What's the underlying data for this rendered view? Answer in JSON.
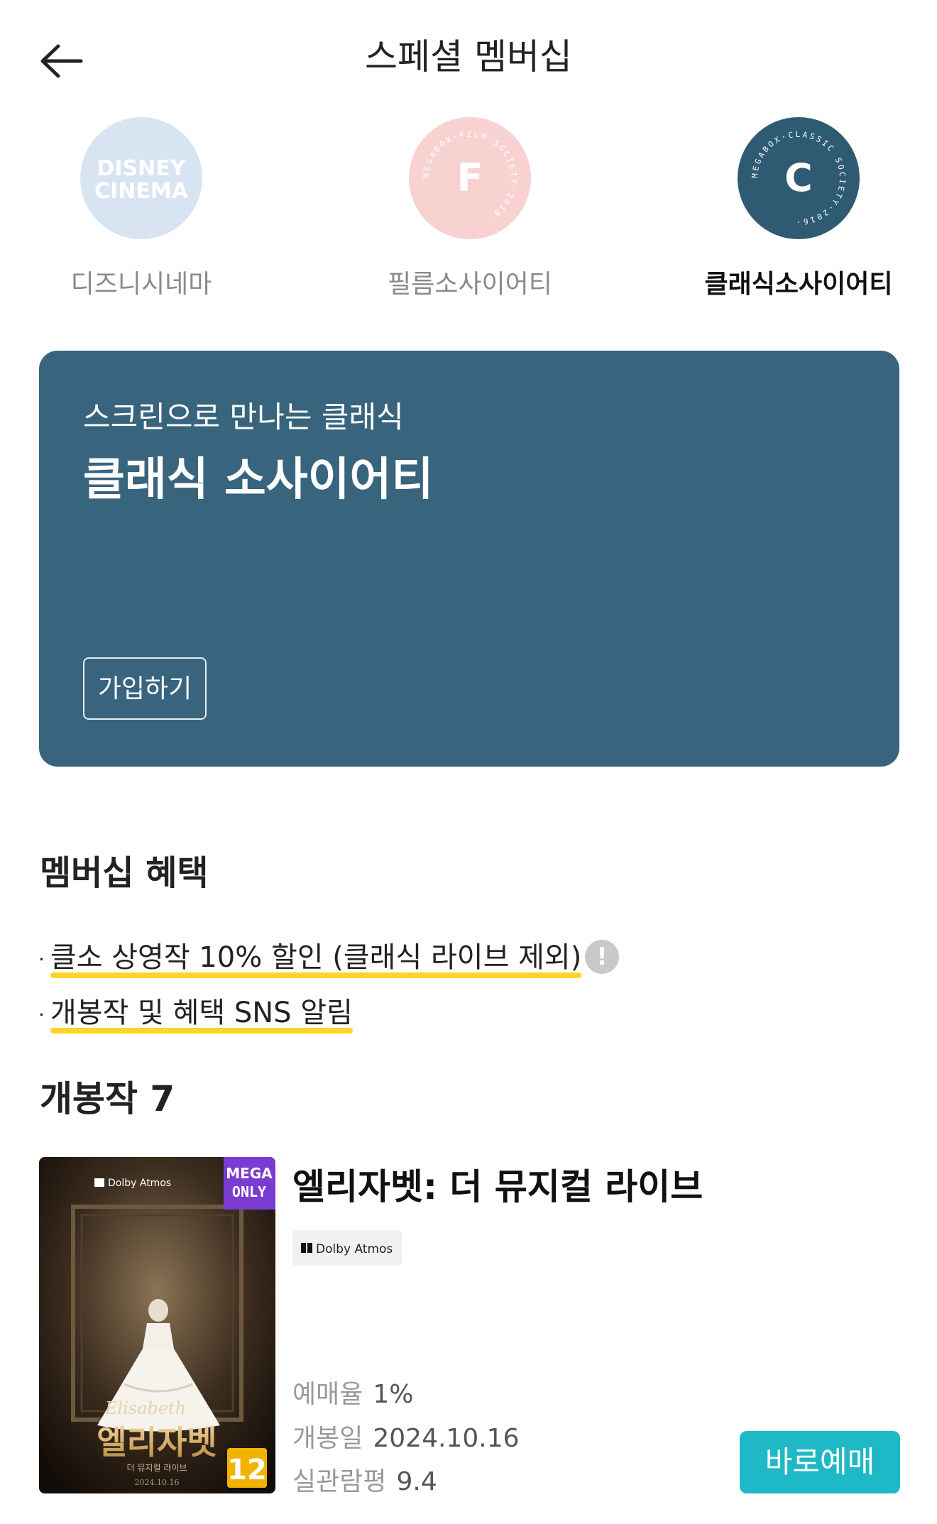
{
  "header": {
    "title": "스페셜 멤버십",
    "back_icon": "arrow-left-icon"
  },
  "tabs": [
    {
      "label": "디즈니시네마",
      "logo_text": "DISNEY CINEMA",
      "color": "#d9e4f3",
      "active": false
    },
    {
      "label": "필름소사이어티",
      "logo_letter": "F",
      "ring_text": "MEGABOX·FILM SOCIETY·2018",
      "color": "#f7d2d1",
      "active": false
    },
    {
      "label": "클래식소사이어티",
      "logo_letter": "C",
      "ring_text": "MEGABOX·CLASSIC SOCIETY·2016",
      "color": "#2f5b72",
      "active": true
    }
  ],
  "banner": {
    "subtitle": "스크린으로 만나는 클래식",
    "title": "클래식 소사이어티",
    "join_label": "가입하기",
    "background": "#38647d"
  },
  "benefits": {
    "title": "멤버십 혜택",
    "items": [
      "클소 상영작 10% 할인 (클래식 라이브 제외)",
      "개봉작 및 혜택 SNS 알림"
    ],
    "info_icon": "!",
    "highlight_color": "#ffd428"
  },
  "releases": {
    "title": "개봉작 7",
    "movies": [
      {
        "title": "엘리자벳: 더 뮤지컬 라이브",
        "badge": "Dolby Atmos",
        "poster": {
          "dolby": "Dolby Atmos",
          "mega_only_1": "MEGA",
          "mega_only_2": "ONLY",
          "script_title": "Elisabeth",
          "korean_title": "엘리자벳",
          "sub": "더 뮤지컬 라이브",
          "date": "2024.10.16",
          "rating": "12"
        },
        "stats": [
          {
            "label": "예매율",
            "value": "1%"
          },
          {
            "label": "개봉일",
            "value": "2024.10.16"
          },
          {
            "label": "실관람평",
            "value": "9.4"
          }
        ],
        "book_label": "바로예매",
        "book_color": "#1fb8c6"
      }
    ]
  }
}
